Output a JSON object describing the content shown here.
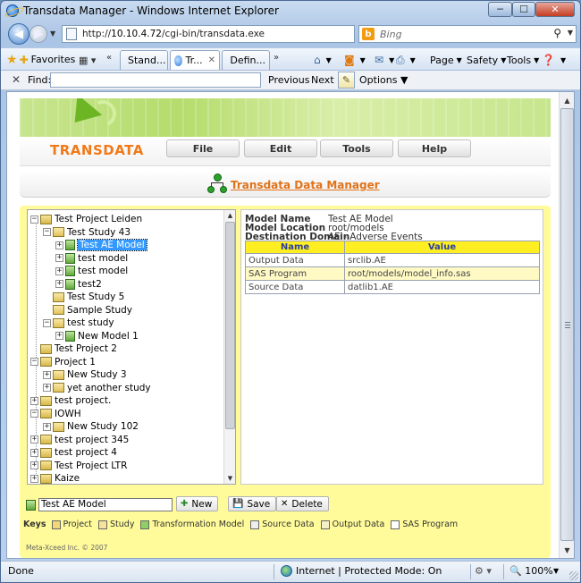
{
  "window": {
    "title": "Transdata Manager - Windows Internet Explorer",
    "controls": {
      "minimize": "─",
      "maximize": "☐",
      "close": "✕"
    }
  },
  "addressbar": {
    "url_prefix": "http://",
    "url_host": "10.10.4.72",
    "url_path": "/cgi-bin/transdata.exe",
    "search_placeholder": "Bing"
  },
  "favorites_bar": {
    "favorites_label": "Favorites",
    "tabs": [
      {
        "label": "Stand...",
        "active": false
      },
      {
        "label": "Tr...",
        "active": true
      },
      {
        "label": "Defin...",
        "active": false
      }
    ],
    "commands": {
      "page": "Page",
      "safety": "Safety",
      "tools": "Tools"
    }
  },
  "findbar": {
    "label": "Find:",
    "value": "",
    "previous": "Previous",
    "next": "Next",
    "options": "Options"
  },
  "app": {
    "brand": "TRANSDATA",
    "menu": [
      "File",
      "Edit",
      "Tools",
      "Help"
    ],
    "section_title": "Transdata Data Manager"
  },
  "tree": {
    "items": [
      {
        "label": "Test Project Leiden",
        "level": 0,
        "kind": "project",
        "expander": "−"
      },
      {
        "label": "Test Study 43",
        "level": 1,
        "kind": "study",
        "expander": "−"
      },
      {
        "label": "Test AE Model",
        "level": 2,
        "kind": "model",
        "expander": "+",
        "selected": true
      },
      {
        "label": "test model",
        "level": 2,
        "kind": "model",
        "expander": "+"
      },
      {
        "label": "test model",
        "level": 2,
        "kind": "model",
        "expander": "+"
      },
      {
        "label": "test2",
        "level": 2,
        "kind": "model",
        "expander": "+"
      },
      {
        "label": "Test Study 5",
        "level": 1,
        "kind": "study",
        "expander": ""
      },
      {
        "label": "Sample Study",
        "level": 1,
        "kind": "study",
        "expander": ""
      },
      {
        "label": "test study",
        "level": 1,
        "kind": "study",
        "expander": "−"
      },
      {
        "label": "New Model 1",
        "level": 2,
        "kind": "model",
        "expander": "+"
      },
      {
        "label": "Test Project 2",
        "level": 0,
        "kind": "project",
        "expander": ""
      },
      {
        "label": "Project 1",
        "level": 0,
        "kind": "project",
        "expander": "−"
      },
      {
        "label": "New Study 3",
        "level": 1,
        "kind": "study",
        "expander": "+"
      },
      {
        "label": "yet another study",
        "level": 1,
        "kind": "study",
        "expander": "+"
      },
      {
        "label": "test project.",
        "level": 0,
        "kind": "project",
        "expander": "+"
      },
      {
        "label": "IOWH",
        "level": 0,
        "kind": "project",
        "expander": "−"
      },
      {
        "label": "New Study 102",
        "level": 1,
        "kind": "study",
        "expander": "+"
      },
      {
        "label": "test project 345",
        "level": 0,
        "kind": "project",
        "expander": "+"
      },
      {
        "label": "test project 4",
        "level": 0,
        "kind": "project",
        "expander": "+"
      },
      {
        "label": "Test Project LTR",
        "level": 0,
        "kind": "project",
        "expander": "+"
      },
      {
        "label": "Kaize",
        "level": 0,
        "kind": "project",
        "expander": "+"
      }
    ]
  },
  "detail": {
    "model_name_label": "Model Name",
    "model_name": "Test AE Model",
    "model_location_label": "Model Location",
    "model_location": "root/models",
    "destination_domain_label": "Destination Domain",
    "destination_domain": "AE - Adverse Events",
    "table": {
      "headers": [
        "Name",
        "Value"
      ],
      "rows": [
        [
          "Output Data",
          "srclib.AE"
        ],
        [
          "SAS Program",
          "root/models/model_info.sas"
        ],
        [
          "Source Data",
          "datlib1.AE"
        ]
      ]
    }
  },
  "controls": {
    "name_value": "Test AE Model",
    "new": "New",
    "save": "Save",
    "delete": "Delete"
  },
  "keys": {
    "label": "Keys",
    "items": [
      "Project",
      "Study",
      "Transformation Model",
      "Source Data",
      "Output Data",
      "SAS Program"
    ]
  },
  "footer": {
    "copyright": "Meta-Xceed Inc. © 2007"
  },
  "statusbar": {
    "status": "Done",
    "zone": "Internet | Protected Mode: On",
    "zoom": "100%"
  }
}
